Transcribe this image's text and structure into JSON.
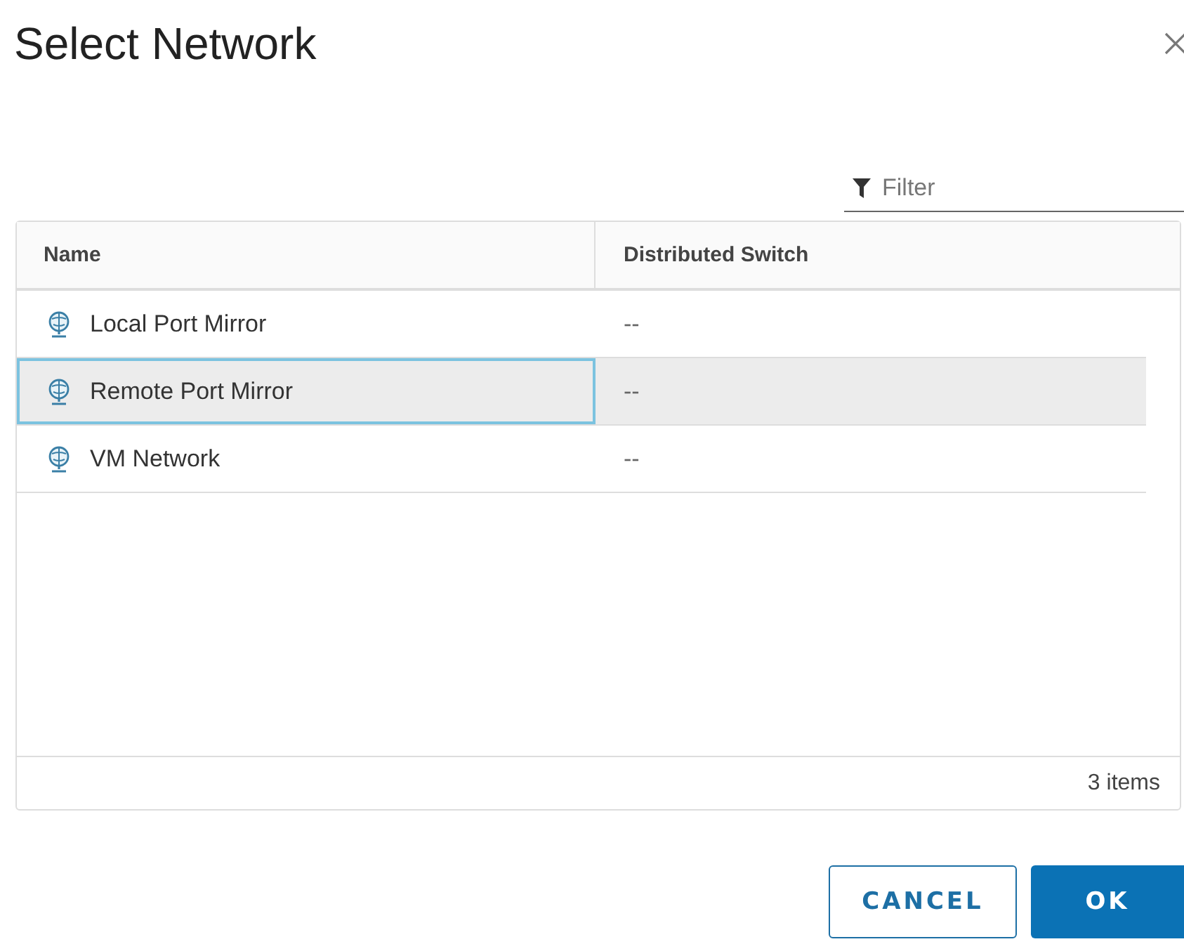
{
  "dialog": {
    "title": "Select Network"
  },
  "filter": {
    "placeholder": "Filter"
  },
  "table": {
    "columns": [
      "Name",
      "Distributed Switch"
    ],
    "rows": [
      {
        "name": "Local Port Mirror",
        "switch": "--",
        "selected": false
      },
      {
        "name": "Remote Port Mirror",
        "switch": "--",
        "selected": true
      },
      {
        "name": "VM Network",
        "switch": "--",
        "selected": false
      }
    ],
    "footer": "3 items"
  },
  "buttons": [
    {
      "label": "CANCEL",
      "kind": "secondary"
    },
    {
      "label": "OK",
      "kind": "primary"
    }
  ]
}
